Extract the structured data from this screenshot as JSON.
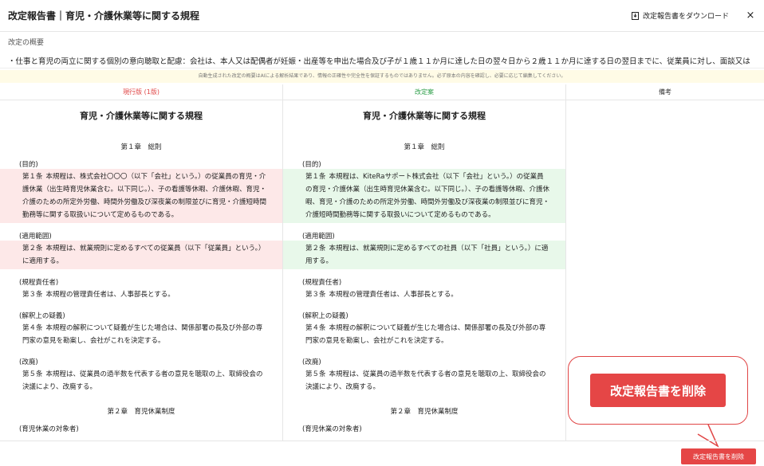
{
  "header": {
    "title": "改定報告書｜育児・介護休業等に関する規程",
    "download_label": "改定報告書をダウンロード",
    "close": "×"
  },
  "summary": {
    "heading": "改定の概要",
    "text": "・仕事と育児の両立に関する個別の意向聴取と配慮：会社は、本人又は配偶者が妊娠・出産等を申出た場合及び子が１歳１１か月に達した日の翌々日から２歳１１か月に達する日の翌日までに、従業員に対し、面談又は"
  },
  "disclaimer": "自動生成された改定の概要はAIによる解析結果であり、情報の正確性や完全性を保証するものではありません。必ず原本の内容を確認し、必要に応じて編集してください。",
  "columns": {
    "current": "現行版 (1版)",
    "revised": "改定案",
    "notes": "備考"
  },
  "doc_title": "育児・介護休業等に関する規程",
  "current": {
    "chapter1": "第１章　総則",
    "sec1": "(目的)",
    "art1_no": "第１条",
    "art1": "本規程は、株式会社〇〇〇（以下「会社」という。）の従業員の育児・介護休業（出生時育児休業含む。以下同じ。）、子の看護等休暇、介護休暇、育児・介護のための所定外労働、時間外労働及び深夜業の制限並びに育児・介護短時間勤務等に関する取扱いについて定めるものである。",
    "sec2": "(適用範囲)",
    "art2_no": "第２条",
    "art2": "本規程は、就業規則に定めるすべての従業員（以下「従業員」という。）に適用する。",
    "sec3": "(規程責任者)",
    "art3_no": "第３条",
    "art3": "本規程の管理責任者は、人事部長とする。",
    "sec4": "(解釈上の疑義)",
    "art4_no": "第４条",
    "art4": "本規程の解釈について疑義が生じた場合は、関係部署の長及び外部の専門家の意見を勘案し、会社がこれを決定する。",
    "sec5": "(改廃)",
    "art5_no": "第５条",
    "art5": "本規程は、従業員の過半数を代表する者の意見を聴取の上、取締役会の決議により、改廃する。",
    "chapter2": "第２章　育児休業制度",
    "sec6": "(育児休業の対象者)"
  },
  "revised": {
    "chapter1": "第１章　総則",
    "sec1": "(目的)",
    "art1_no": "第１条",
    "art1": "本規程は、KiteRaサポート株式会社（以下「会社」という。）の従業員の育児・介護休業（出生時育児休業含む。以下同じ。）、子の看護等休暇、介護休暇、育児・介護のための所定外労働、時間外労働及び深夜業の制限並びに育児・介護短時間勤務等に関する取扱いについて定めるものである。",
    "sec2": "(適用範囲)",
    "art2_no": "第２条",
    "art2": "本規程は、就業規則に定めるすべての社員（以下「社員」という。）に適用する。",
    "sec3": "(規程責任者)",
    "art3_no": "第３条",
    "art3": "本規程の管理責任者は、人事部長とする。",
    "sec4": "(解釈上の疑義)",
    "art4_no": "第４条",
    "art4": "本規程の解釈について疑義が生じた場合は、関係部署の長及び外部の専門家の意見を勘案し、会社がこれを決定する。",
    "sec5": "(改廃)",
    "art5_no": "第５条",
    "art5": "本規程は、従業員の過半数を代表する者の意見を聴取の上、取締役会の決議により、改廃する。",
    "chapter2": "第２章　育児休業制度",
    "sec6": "(育児休業の対象者)"
  },
  "delete_big": "改定報告書を削除",
  "delete_small": "改定報告書を削除",
  "colors": {
    "accent": "#e54646",
    "removed": "#fde8e8",
    "added": "#e8f8ea"
  }
}
